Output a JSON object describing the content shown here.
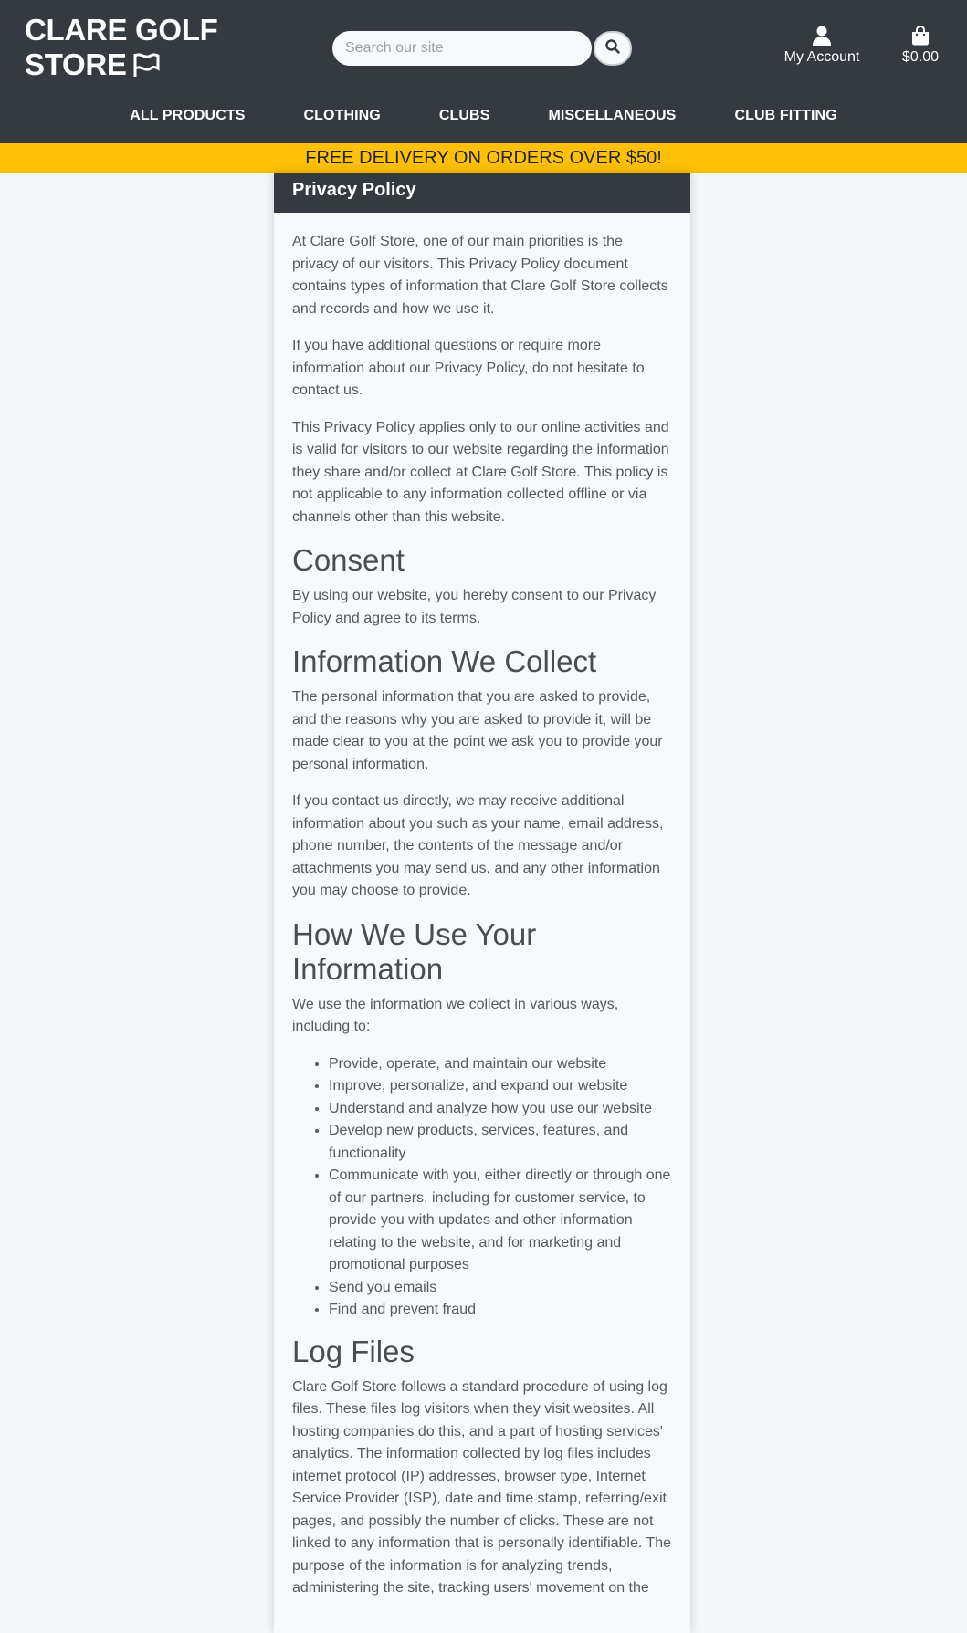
{
  "header": {
    "logo_line1": "CLARE GOLF",
    "logo_line2": "STORE",
    "search_placeholder": "Search our site",
    "account_label": "My Account",
    "cart_total": "$0.00",
    "nav": [
      "ALL PRODUCTS",
      "CLOTHING",
      "CLUBS",
      "MISCELLANEOUS",
      "CLUB FITTING"
    ]
  },
  "banner": {
    "text": "FREE DELIVERY ON ORDERS OVER $50!"
  },
  "policy": {
    "title": "Privacy Policy",
    "intro": [
      "At Clare Golf Store, one of our main priorities is the privacy of our visitors. This Privacy Policy document contains types of information that Clare Golf Store collects and records and how we use it.",
      "If you have additional questions or require more information about our Privacy Policy, do not hesitate to contact us.",
      "This Privacy Policy applies only to our online activities and is valid for visitors to our website regarding the information they share and/or collect at Clare Golf Store. This policy is not applicable to any information collected offline or via channels other than this website."
    ],
    "consent": {
      "heading": "Consent",
      "text": "By using our website, you hereby consent to our Privacy Policy and agree to its terms."
    },
    "collect": {
      "heading": "Information We Collect",
      "paragraphs": [
        "The personal information that you are asked to provide, and the reasons why you are asked to provide it, will be made clear to you at the point we ask you to provide your personal information.",
        "If you contact us directly, we may receive additional information about you such as your name, email address, phone number, the contents of the message and/or attachments you may send us, and any other information you may choose to provide."
      ]
    },
    "use": {
      "heading": "How We Use Your Information",
      "intro": "We use the information we collect in various ways, including to:",
      "items": [
        "Provide, operate, and maintain our website",
        "Improve, personalize, and expand our website",
        "Understand and analyze how you use our website",
        "Develop new products, services, features, and functionality",
        "Communicate with you, either directly or through one of our partners, including for customer service, to provide you with updates and other information relating to the website, and for marketing and promotional purposes",
        "Send you emails",
        "Find and prevent fraud"
      ]
    },
    "logs": {
      "heading": "Log Files",
      "text": "Clare Golf Store follows a standard procedure of using log files. These files log visitors when they visit websites. All hosting companies do this, and a part of hosting services' analytics. The information collected by log files includes internet protocol (IP) addresses, browser type, Internet Service Provider (ISP), date and time stamp, referring/exit pages, and possibly the number of clicks. These are not linked to any information that is personally identifiable. The purpose of the information is for analyzing trends, administering the site, tracking users' movement on the"
    }
  }
}
